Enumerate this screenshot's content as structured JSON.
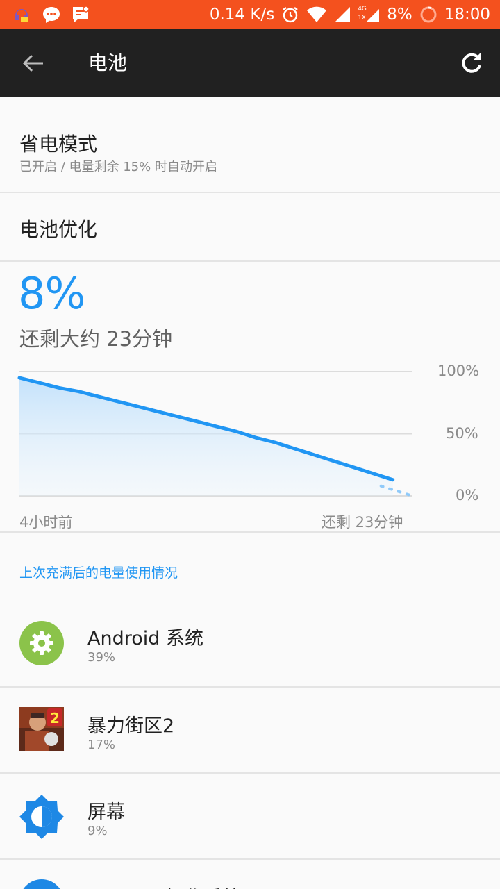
{
  "status_bar": {
    "net_speed": "0.14 K/s",
    "battery": "8%",
    "time": "18:00",
    "network_badge": "4G",
    "network_badge2": "1X",
    "bar_color": "#f4511e"
  },
  "app_bar": {
    "title": "电池",
    "back_icon": "arrow-left-icon",
    "refresh_icon": "refresh-icon"
  },
  "power_saving": {
    "title": "省电模式",
    "subtitle": "已开启 / 电量剩余 15% 时自动开启"
  },
  "optimization": {
    "title": "电池优化"
  },
  "battery": {
    "percent": "8%",
    "remaining": "还剩大约 23分钟",
    "accent_color": "#2196f3"
  },
  "chart_data": {
    "type": "area",
    "x_start_label": "4小时前",
    "x_end_label": "还剩 23分钟",
    "y_tick_labels": [
      "100%",
      "50%",
      "0%"
    ],
    "ylim": [
      0,
      100
    ],
    "x": [
      0,
      0.05,
      0.1,
      0.15,
      0.2,
      0.25,
      0.3,
      0.35,
      0.4,
      0.45,
      0.5,
      0.55,
      0.6,
      0.65,
      0.7,
      0.75,
      0.8,
      0.85,
      0.9,
      0.95
    ],
    "values": [
      95,
      91,
      87,
      84,
      80,
      76,
      72,
      68,
      64,
      60,
      56,
      52,
      47,
      43,
      38,
      33,
      28,
      23,
      18,
      13
    ],
    "projected_x": [
      0.92,
      0.95,
      1.0
    ],
    "projected_values": [
      8,
      5,
      0
    ],
    "grid": true,
    "line_color": "#2196f3"
  },
  "usage": {
    "header": "上次充满后的电量使用情况",
    "items": [
      {
        "name": "Android 系统",
        "percent": "39%",
        "icon": "gear-icon"
      },
      {
        "name": "暴力街区2",
        "percent": "17%",
        "icon": "game-icon"
      },
      {
        "name": "屏幕",
        "percent": "9%",
        "icon": "brightness-icon"
      },
      {
        "name": "Android 操作系统",
        "percent": "",
        "icon": "android-icon"
      }
    ]
  }
}
